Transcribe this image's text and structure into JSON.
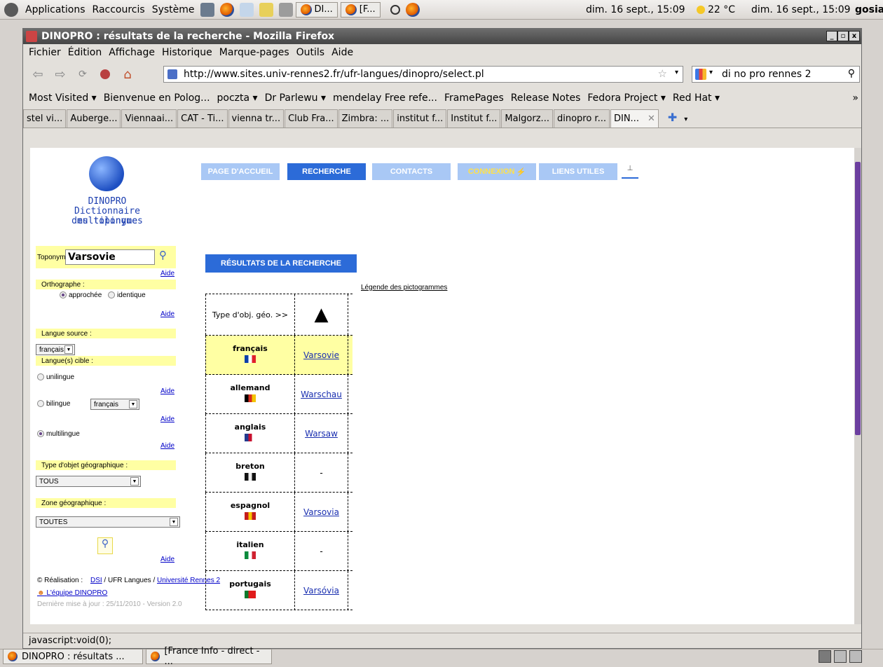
{
  "panel": {
    "menus": [
      "Applications",
      "Raccourcis",
      "Système"
    ],
    "task_tabs": [
      "DI...",
      "[F..."
    ],
    "date1": "dim. 16 sept., 15:09",
    "weather": "22 °C",
    "date2": "dim. 16 sept., 15:09",
    "user": "gosia"
  },
  "window": {
    "title": "DINOPRO : résultats de la recherche - Mozilla Firefox",
    "menu": [
      "Fichier",
      "Édition",
      "Affichage",
      "Historique",
      "Marque-pages",
      "Outils",
      "Aide"
    ],
    "url": "http://www.sites.univ-rennes2.fr/ufr-langues/dinopro/select.pl",
    "search": "di no pro rennes 2",
    "bookmarks": [
      "Most Visited ▾",
      "Bienvenue en Polog...",
      "poczta ▾",
      "Dr Parlewu ▾",
      "mendelay Free refe...",
      "FramePages",
      "Release Notes",
      "Fedora Project ▾",
      "Red Hat ▾"
    ],
    "tabs": [
      "stel vi...",
      "Auberge...",
      "Viennaai...",
      "CAT - Ti...",
      "vienna tr...",
      "Club Fra...",
      "Zimbra: ...",
      "institut f...",
      "Institut f...",
      "Malgorz...",
      "dinopro r...",
      "DIN..."
    ],
    "status": "javascript:void(0);"
  },
  "page": {
    "logo_title": "DINOPRO",
    "logo_sub1": "Dictionnaire multilingue",
    "logo_sub2": "des toponymes",
    "nav": [
      "PAGE D'ACCUEIL",
      "RECHERCHE",
      "CONTACTS",
      "CONNEXION",
      "LIENS UTILES"
    ],
    "toponyme_label": "Toponyme",
    "toponyme_value": "Varsovie",
    "aide": "Aide",
    "orthographe_label": "Orthographe :",
    "ortho_approx": "approchée",
    "ortho_ident": "identique",
    "langue_source_label": "Langue source :",
    "langue_source_value": "français",
    "langues_cible_label": "Langue(s) cible :",
    "unilingue": "unilingue",
    "bilingue": "bilingue",
    "bilingue_value": "français",
    "multilingue": "multilingue",
    "type_objet_label": "Type d'objet géographique :",
    "type_objet_value": "TOUS",
    "zone_label": "Zone géographique :",
    "zone_value": "TOUTES",
    "realisation": "© Réalisation :",
    "dsi": "DSI",
    "ufr": " / UFR Langues / ",
    "universite": "Université Rennes 2",
    "equipe": "L'équipe DINOPRO",
    "maj": "Dernière mise à jour : 25/11/2010 - Version 2.0",
    "results_title": "RÉSULTATS DE LA RECHERCHE",
    "legende": "Légende des pictogrammes",
    "type_obj_geo": "Type d'obj. géo. >>",
    "results": [
      {
        "lang": "français",
        "value": "Varsovie",
        "link": true,
        "highlight": true
      },
      {
        "lang": "allemand",
        "value": "Warschau",
        "link": true
      },
      {
        "lang": "anglais",
        "value": "Warsaw",
        "link": true
      },
      {
        "lang": "breton",
        "value": "-",
        "link": false
      },
      {
        "lang": "espagnol",
        "value": "Varsovia",
        "link": true
      },
      {
        "lang": "italien",
        "value": "-",
        "link": false
      },
      {
        "lang": "portugais",
        "value": "Varsóvia",
        "link": true
      }
    ]
  },
  "taskbar": [
    "DINOPRO : résultats ...",
    "[France Info - direct - ..."
  ]
}
